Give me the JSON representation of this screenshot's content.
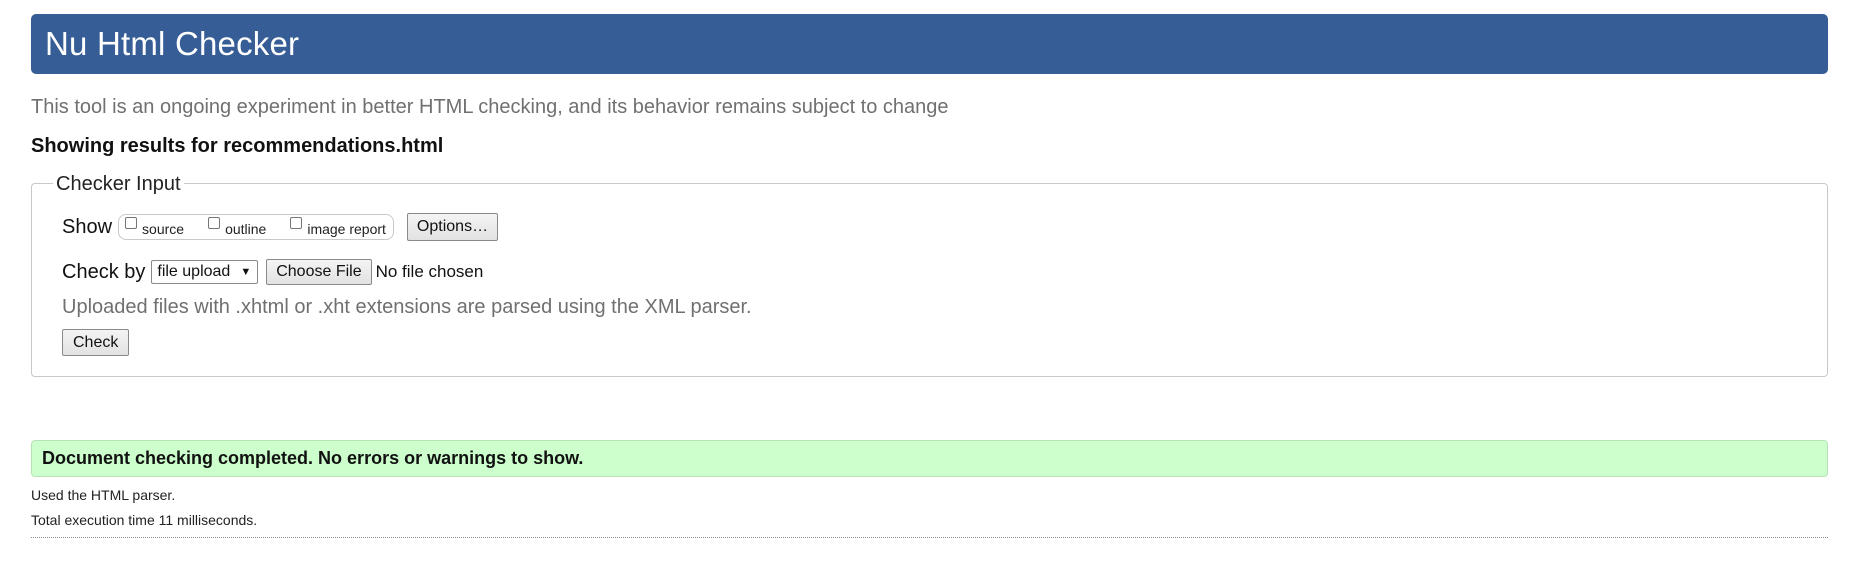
{
  "header": {
    "title": "Nu Html Checker",
    "background_color": "#365d95"
  },
  "tagline": "This tool is an ongoing experiment in better HTML checking, and its behavior remains subject to change",
  "results": {
    "prefix": "Showing results for ",
    "filename": "recommendations.html"
  },
  "checker_input": {
    "legend": "Checker Input",
    "show_label": "Show",
    "show_options": [
      {
        "label": "source",
        "checked": false
      },
      {
        "label": "outline",
        "checked": false
      },
      {
        "label": "image report",
        "checked": false
      }
    ],
    "options_button": "Options…",
    "check_by_label": "Check by",
    "check_by_selected": "file upload",
    "choose_file_button": "Choose File",
    "file_status": "No file chosen",
    "note": "Uploaded files with .xhtml or .xht extensions are parsed using the XML parser.",
    "check_button": "Check"
  },
  "status": {
    "message": "Document checking completed. No errors or warnings to show.",
    "background_color": "#ccffcc",
    "parser_info": "Used the HTML parser.",
    "execution_time": "Total execution time 11 milliseconds."
  }
}
